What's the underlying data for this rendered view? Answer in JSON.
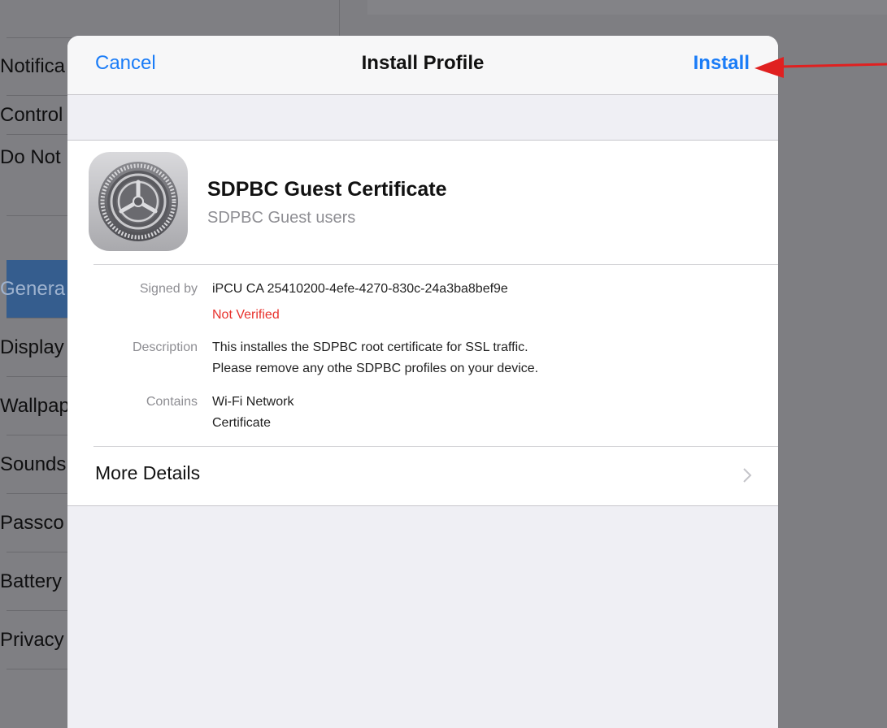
{
  "sidebar": {
    "items": [
      {
        "label": "Notifica"
      },
      {
        "label": "Control"
      },
      {
        "label": "Do Not"
      },
      {
        "label": "Genera"
      },
      {
        "label": "Display"
      },
      {
        "label": "Wallpap"
      },
      {
        "label": "Sounds"
      },
      {
        "label": "Passco"
      },
      {
        "label": "Battery"
      },
      {
        "label": "Privacy"
      }
    ]
  },
  "modal": {
    "cancel_label": "Cancel",
    "title": "Install Profile",
    "install_label": "Install",
    "profile": {
      "icon": "settings-gear-icon",
      "name": "SDPBC Guest Certificate",
      "subtitle": "SDPBC Guest users"
    },
    "details": {
      "signed_by_label": "Signed by",
      "signed_by_value": "iPCU CA 25410200-4efe-4270-830c-24a3ba8bef9e",
      "verification_status": "Not Verified",
      "description_label": "Description",
      "description_line1": "This installes the SDPBC root certificate for SSL traffic.",
      "description_line2": "Please remove any othe SDPBC profiles on your device.",
      "contains_label": "Contains",
      "contains_item1": "Wi-Fi Network",
      "contains_item2": "Certificate"
    },
    "more_details_label": "More Details"
  },
  "colors": {
    "accent": "#1a7cf7",
    "warning": "#e8332e",
    "annotation_arrow": "#e02020"
  }
}
